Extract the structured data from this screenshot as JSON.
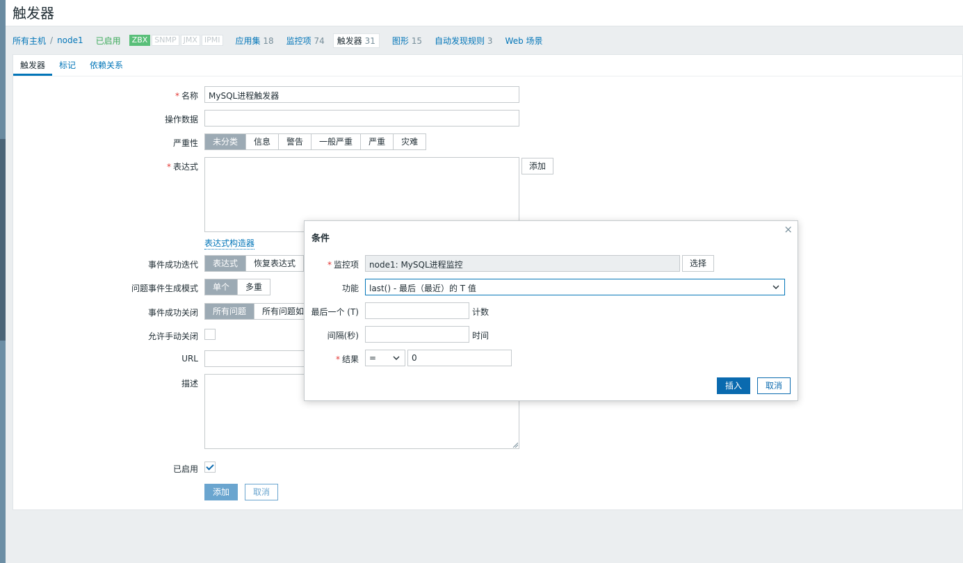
{
  "header": {
    "title": "触发器"
  },
  "breadcrumb": {
    "all_hosts": "所有主机",
    "sep": "/",
    "host": "node1",
    "status": "已启用",
    "badges": [
      "ZBX",
      "SNMP",
      "JMX",
      "IPMI"
    ],
    "nav": [
      {
        "label": "应用集",
        "count": "18"
      },
      {
        "label": "监控项",
        "count": "74"
      },
      {
        "label": "触发器",
        "count": "31"
      },
      {
        "label": "图形",
        "count": "15"
      },
      {
        "label": "自动发现规则",
        "count": "3"
      },
      {
        "label": "Web 场景",
        "count": ""
      }
    ]
  },
  "tabs": [
    "触发器",
    "标记",
    "依赖关系"
  ],
  "form": {
    "name_label": "名称",
    "name_value": "MySQL进程触发器",
    "opdata_label": "操作数据",
    "opdata_value": "",
    "severity_label": "严重性",
    "severity_options": [
      "未分类",
      "信息",
      "警告",
      "一般严重",
      "严重",
      "灾难"
    ],
    "expression_label": "表达式",
    "expression_value": "",
    "add_button": "添加",
    "constructor_link": "表达式构造器",
    "ok_event_label": "事件成功迭代",
    "ok_event_options": [
      "表达式",
      "恢复表达式"
    ],
    "problem_mode_label": "问题事件生成模式",
    "problem_mode_options": [
      "单个",
      "多重"
    ],
    "ok_close_label": "事件成功关闭",
    "ok_close_options": [
      "所有问题",
      "所有问题如"
    ],
    "manual_close_label": "允许手动关闭",
    "url_label": "URL",
    "url_value": "",
    "desc_label": "描述",
    "desc_value": "",
    "enabled_label": "已启用",
    "submit_button": "添加",
    "cancel_button": "取消"
  },
  "dialog": {
    "title": "条件",
    "close": "×",
    "item_label": "监控项",
    "item_value": "node1: MySQL进程监控",
    "select_button": "选择",
    "function_label": "功能",
    "function_value": "last() - 最后（最近）的 T 值",
    "last_label": "最后一个 (T)",
    "last_value": "",
    "last_suffix": "计数",
    "interval_label": "间隔(秒)",
    "interval_value": "",
    "interval_suffix": "时间",
    "result_label": "结果",
    "operator_value": "=",
    "result_value": "0",
    "insert_button": "插入",
    "cancel_button": "取消"
  },
  "colors": {
    "accent": "#0275b8",
    "primary_button": "#0a6aaf",
    "selected_segment": "#9caab4",
    "enabled": "#3daa5b",
    "required": "#e33734"
  }
}
